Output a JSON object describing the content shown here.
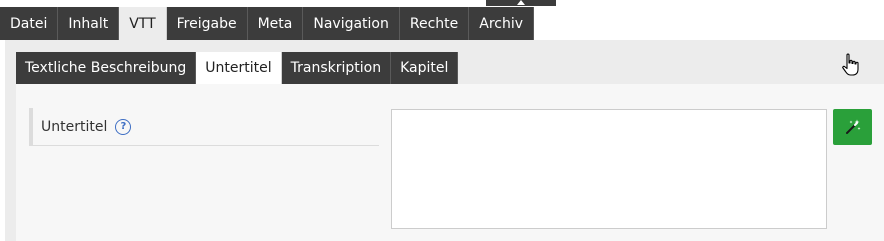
{
  "top_tabs": [
    {
      "label": "Datei",
      "active": false
    },
    {
      "label": "Inhalt",
      "active": false
    },
    {
      "label": "VTT",
      "active": true
    },
    {
      "label": "Freigabe",
      "active": false
    },
    {
      "label": "Meta",
      "active": false
    },
    {
      "label": "Navigation",
      "active": false
    },
    {
      "label": "Rechte",
      "active": false
    },
    {
      "label": "Archiv",
      "active": false
    }
  ],
  "sub_tabs": [
    {
      "label": "Textliche Beschreibung",
      "active": false
    },
    {
      "label": "Untertitel",
      "active": true
    },
    {
      "label": "Transkription",
      "active": false
    },
    {
      "label": "Kapitel",
      "active": false
    }
  ],
  "field": {
    "label": "Untertitel",
    "help_icon": "?",
    "value": ""
  },
  "colors": {
    "tab_bg": "#3c3c3c",
    "panel_bg": "#ececec",
    "accent_green": "#2aa03a",
    "help_blue": "#3f6fc4"
  },
  "icons": {
    "magic_button": "magic-wand-icon",
    "help": "help-icon"
  }
}
